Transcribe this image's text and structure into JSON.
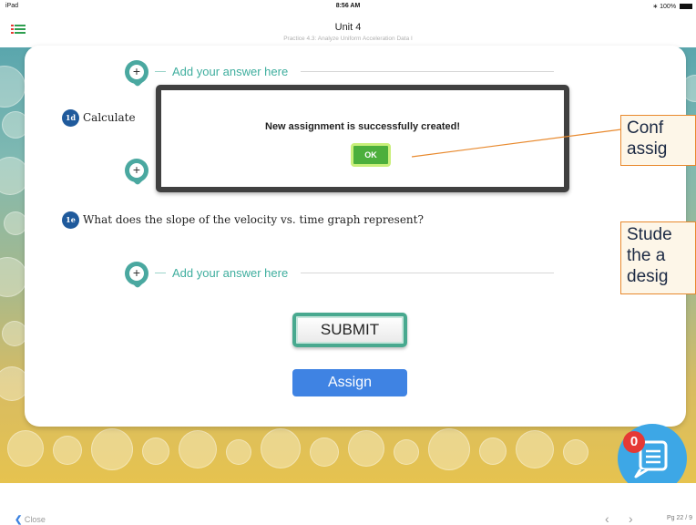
{
  "status_bar": {
    "device": "iPad",
    "time": "8:56 AM",
    "battery": "100%"
  },
  "header": {
    "title": "Unit 4",
    "subtitle": "Practice 4.3: Analyze Uniform Acceleration Data I",
    "menu_icon": "list-icon"
  },
  "questions": {
    "answer_placeholder": "Add your answer here",
    "q1d": {
      "badge": "1d",
      "text": "Calculate"
    },
    "q1e": {
      "badge": "1e",
      "text": "What does the slope of the velocity vs. time graph represent?"
    }
  },
  "buttons": {
    "submit": "SUBMIT",
    "assign": "Assign"
  },
  "dialog": {
    "message": "New assignment is successfully created!",
    "ok": "OK"
  },
  "callouts": {
    "confirm": [
      "Conf",
      "assig"
    ],
    "student": [
      "Stude",
      "the a",
      "desig"
    ],
    "border_color": "#e8892d"
  },
  "chat": {
    "badge_count": "0",
    "icon": "chat-icon"
  },
  "footer": {
    "close": "Close",
    "page": "Pg 22 / 9"
  },
  "colors": {
    "teal_accent": "#4aa8a0",
    "assign_blue": "#3f83e3",
    "ok_green": "#4caf3c",
    "badge_red": "#e53935"
  }
}
